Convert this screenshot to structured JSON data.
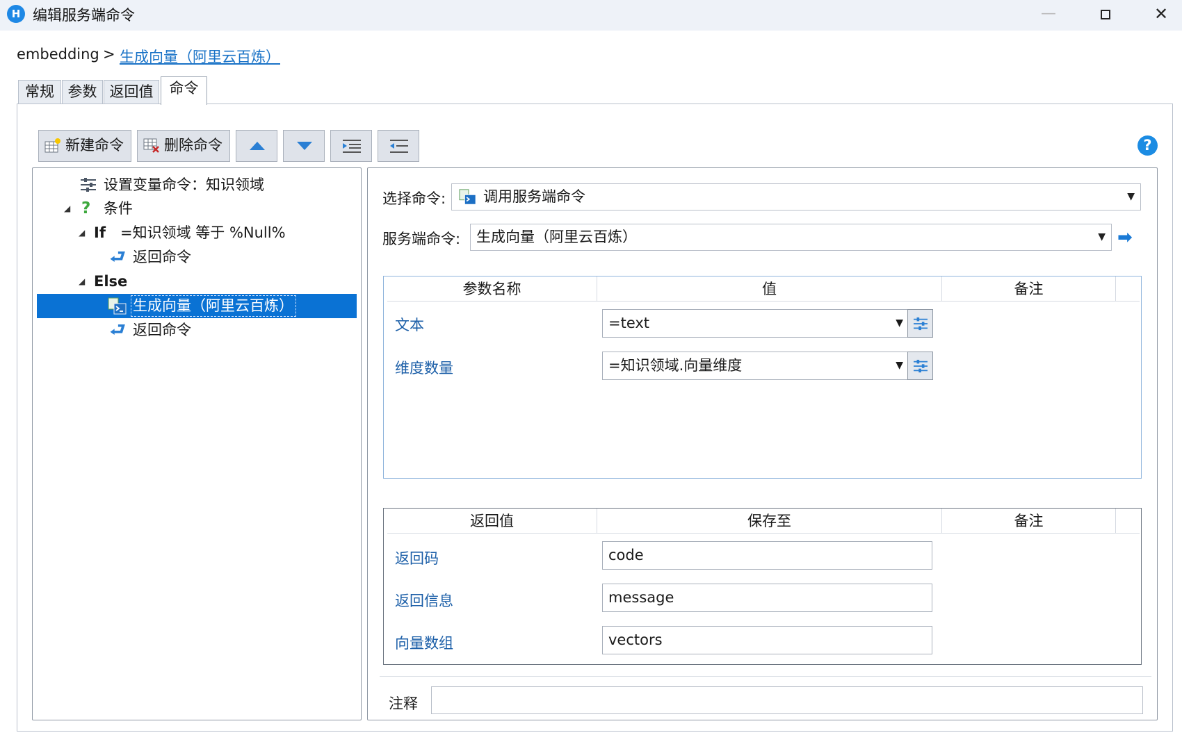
{
  "window": {
    "title": "编辑服务端命令",
    "app_icon": "H"
  },
  "breadcrumb": {
    "root": "embedding",
    "separator": ">",
    "current": "生成向量（阿里云百炼）"
  },
  "tabs": [
    {
      "label": "常规"
    },
    {
      "label": "参数"
    },
    {
      "label": "返回值"
    },
    {
      "label": "命令"
    }
  ],
  "toolbar": {
    "new_label": "新建命令",
    "delete_label": "删除命令"
  },
  "tree": {
    "set_var": "设置变量命令：知识领域",
    "condition": "条件",
    "if_keyword": "If",
    "if_expr": "=知识领域 等于 %Null%",
    "if_return": "返回命令",
    "else_keyword": "Else",
    "selected_item": "生成向量（阿里云百炼）",
    "else_return": "返回命令"
  },
  "detail": {
    "select_label": "选择命令:",
    "select_value": "调用服务端命令",
    "server_label": "服务端命令:",
    "server_value": "生成向量（阿里云百炼）",
    "params": {
      "headers": [
        "参数名称",
        "值",
        "备注"
      ],
      "rows": [
        {
          "name": "文本",
          "value": "=text"
        },
        {
          "name": "维度数量",
          "value": "=知识领域.向量维度"
        }
      ]
    },
    "returns": {
      "headers": [
        "返回值",
        "保存至",
        "备注"
      ],
      "rows": [
        {
          "name": "返回码",
          "value": "code"
        },
        {
          "name": "返回信息",
          "value": "message"
        },
        {
          "name": "向量数组",
          "value": "vectors"
        }
      ]
    },
    "comment_label": "注释"
  },
  "colors": {
    "accent": "#0a72d4",
    "link": "#1a73c7",
    "param_name": "#1c5fa8"
  }
}
